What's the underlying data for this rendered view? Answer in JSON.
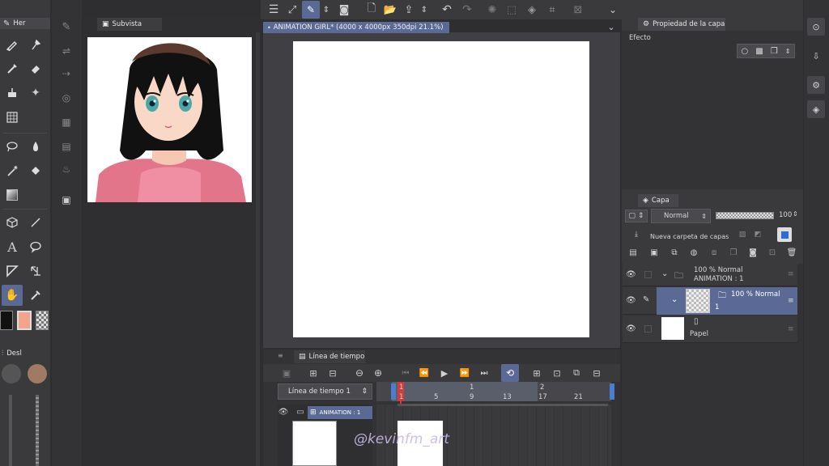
{
  "left_tools": {
    "tab_label": "Her",
    "color_tab_label": "Desl"
  },
  "subview": {
    "title": "Subvista"
  },
  "canvas": {
    "tab_title": "ANIMATION GIRL* (4000 x 4000px 350dpi 21.1%)"
  },
  "layer_property": {
    "title": "Propiedad de la capa",
    "effect_label": "Efecto"
  },
  "layers": {
    "title": "Capa",
    "blend_mode": "Normal",
    "opacity": "100",
    "new_folder_label": "Nueva carpeta de capas",
    "rows": [
      {
        "line1": "100 % Normal",
        "line2": "ANIMATION : 1"
      },
      {
        "line1": "100 % Normal",
        "line2": "1"
      },
      {
        "line1": "Papel",
        "line2": ""
      }
    ]
  },
  "timeline": {
    "title": "Línea de tiempo",
    "selector": "Línea de tiempo 1",
    "track_label": "ANIMATION : 1",
    "frames_top": [
      "1",
      "1",
      "2"
    ],
    "frames": [
      "1",
      "5",
      "9",
      "13",
      "17",
      "21"
    ]
  },
  "watermark": "@kevinfm_art",
  "colors": {
    "main_color": "#f2a48c",
    "accent": "#5a6a95",
    "playhead": "#d23b3b"
  }
}
